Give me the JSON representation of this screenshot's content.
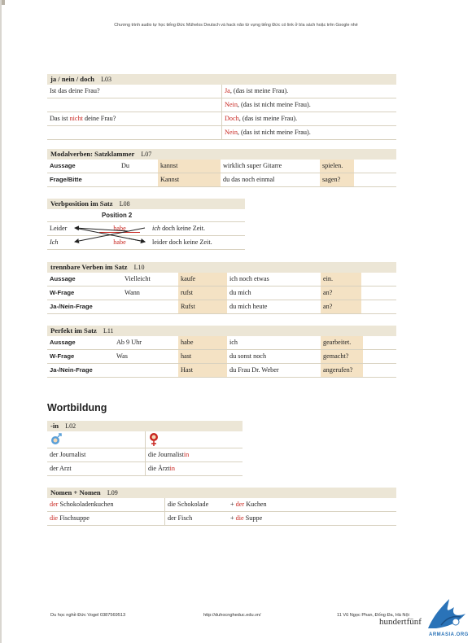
{
  "top_note": "Chương trình audio tự học tiếng Đức Mühelos Deutsch và hack não từ vựng tiếng Đức có link ở bìa sách hoặc trên Google nhé",
  "ja_nein": {
    "title": "ja / nein / doch",
    "code": "L03",
    "q1": "Ist das deine Frau?",
    "a1_kw": "Ja",
    "a1_rest": ", (das ist meine Frau).",
    "a2_kw": "Nein",
    "a2_rest": ", (das ist nicht meine Frau).",
    "q2_pre": "Das ist ",
    "q2_kw": "nicht",
    "q2_post": " deine Frau?",
    "a3_kw": "Doch",
    "a3_rest": ", (das ist meine Frau).",
    "a4_kw": "Nein",
    "a4_rest": ", (das ist nicht meine Frau)."
  },
  "modal": {
    "title": "Modalverben: Satzklammer",
    "code": "L07",
    "rows": [
      {
        "label": "Aussage",
        "c1": "Du",
        "c2": "kannst",
        "c3": "wirklich super Gitarre",
        "c4": "spielen."
      },
      {
        "label": "Frage/Bitte",
        "c1": "",
        "c2": "Kannst",
        "c3": "du das noch einmal",
        "c4": "sagen?"
      }
    ]
  },
  "verbpos": {
    "title": "Verbposition im Satz",
    "code": "L08",
    "pos_label": "Position 2",
    "r1_left": "Leider",
    "r1_verb": "habe",
    "r1_right_it": "ich",
    "r1_right": " doch keine Zeit.",
    "r2_left": "Ich",
    "r2_verb": "habe",
    "r2_right": "leider doch keine Zeit."
  },
  "trennbar": {
    "title": "trennbare Verben im Satz",
    "code": "L10",
    "rows": [
      {
        "label": "Aussage",
        "c1": "Vielleicht",
        "c2": "kaufe",
        "c3": "ich noch etwas",
        "c4": "ein."
      },
      {
        "label": "W-Frage",
        "c1": "Wann",
        "c2": "rufst",
        "c3": "du mich",
        "c4": "an?"
      },
      {
        "label": "Ja-/Nein-Frage",
        "c1": "",
        "c2": "Rufst",
        "c3": "du mich heute",
        "c4": "an?"
      }
    ]
  },
  "perfekt": {
    "title": "Perfekt im Satz",
    "code": "L11",
    "rows": [
      {
        "label": "Aussage",
        "c1": "Ab 9 Uhr",
        "c2": "habe",
        "c3": "ich",
        "c4": "gearbeitet."
      },
      {
        "label": "W-Frage",
        "c1": "Was",
        "c2": "hast",
        "c3": "du sonst noch",
        "c4": "gemacht?"
      },
      {
        "label": "Ja-/Nein-Frage",
        "c1": "",
        "c2": "Hast",
        "c3": "du Frau Dr. Weber",
        "c4": "angerufen?"
      }
    ]
  },
  "wortbildung": "Wortbildung",
  "in_box": {
    "title": "-in",
    "code": "L02",
    "r1_m": "der Journalist",
    "r1_f_base": "die Journalist",
    "r1_f_suffix": "in",
    "r2_m": "der Arzt",
    "r2_f_base": "die Ärzt",
    "r2_f_suffix": "in"
  },
  "nomen": {
    "title": "Nomen + Nomen",
    "code": "L09",
    "r1_art": "der",
    "r1_word": " Schokoladenkuchen",
    "r1_c2": "die Schokolade",
    "r1_plus": "+ ",
    "r1_c3_art": "der",
    "r1_c3": " Kuchen",
    "r2_art": "die",
    "r2_word": " Fischsuppe",
    "r2_c2": "der Fisch",
    "r2_plus": "+ ",
    "r2_c3_art": "die",
    "r2_c3": " Suppe"
  },
  "footer": {
    "left": "Du học nghề Đức Vogel 0387569513",
    "center": "http://duhocngheduc.edu.vn/",
    "right": "11 Vũ Ngọc Phan, Đống Đa, Hà Nội",
    "brand": "hundertfünf",
    "watermark": "ARMASIA.ORG"
  },
  "colors": {
    "header_bg": "#ece6d6",
    "highlight": "#f4e2c4",
    "red": "#c8261f",
    "orange": "#c76a12"
  }
}
